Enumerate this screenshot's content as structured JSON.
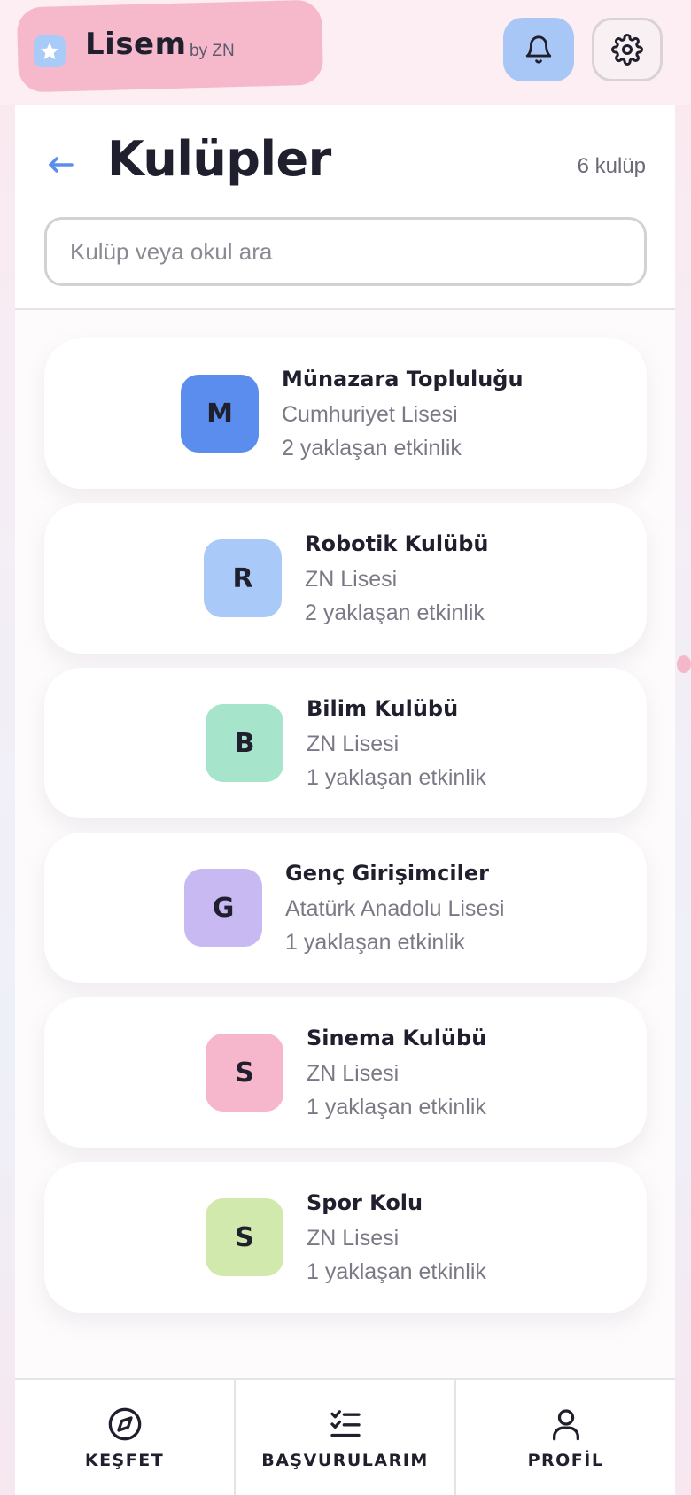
{
  "app": {
    "name": "Lisem",
    "byline": "by ZN"
  },
  "header": {
    "title": "Kulüpler",
    "count": "6 kulüp",
    "search_placeholder": "Kulüp veya okul ara"
  },
  "clubs": [
    {
      "initial": "M",
      "name": "Münazara Topluluğu",
      "school": "Cumhuriyet Lisesi",
      "events": "2 yaklaşan etkinlik",
      "color": "#5b8def"
    },
    {
      "initial": "R",
      "name": "Robotik Kulübü",
      "school": "ZN Lisesi",
      "events": "2 yaklaşan etkinlik",
      "color": "#a9c9f8"
    },
    {
      "initial": "B",
      "name": "Bilim Kulübü",
      "school": "ZN Lisesi",
      "events": "1 yaklaşan etkinlik",
      "color": "#a6e5cc"
    },
    {
      "initial": "G",
      "name": "Genç Girişimciler",
      "school": "Atatürk Anadolu Lisesi",
      "events": "1 yaklaşan etkinlik",
      "color": "#c9b9f3"
    },
    {
      "initial": "S",
      "name": "Sinema Kulübü",
      "school": "ZN Lisesi",
      "events": "1 yaklaşan etkinlik",
      "color": "#f6b6cb"
    },
    {
      "initial": "S",
      "name": "Spor Kolu",
      "school": "ZN Lisesi",
      "events": "1 yaklaşan etkinlik",
      "color": "#d2e9ad"
    }
  ],
  "nav": {
    "explore": "KEŞFET",
    "applications": "BAŞVURULARIM",
    "profile": "PROFİL"
  },
  "icons": {
    "brand": "star-icon",
    "notifications": "bell-icon",
    "settings": "gear-icon",
    "back": "arrow-left-icon",
    "explore": "compass-icon",
    "applications": "checklist-icon",
    "profile": "user-icon"
  },
  "colors": {
    "accent": "#5b8def",
    "brand_pill": "#f6b9cc",
    "bell_button": "#a9c7f6"
  }
}
